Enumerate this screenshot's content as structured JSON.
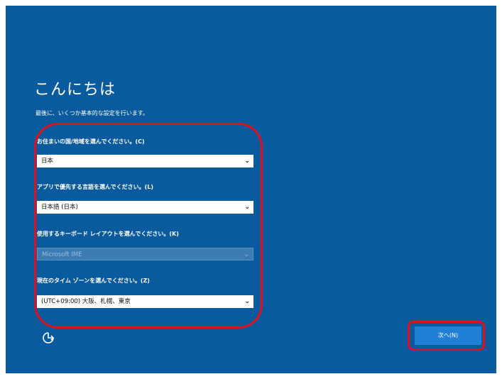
{
  "screen": {
    "title": "こんにちは",
    "subtitle": "最後に、いくつか基本的な設定を行います。"
  },
  "fields": {
    "region": {
      "label": "お住まいの国/地域を選んでください。(C)",
      "value": "日本"
    },
    "language": {
      "label": "アプリで優先する言語を選んでください。(L)",
      "value": "日本語 (日本)"
    },
    "keyboard": {
      "label": "使用するキーボード レイアウトを選んでください。(K)",
      "value": "Microsoft IME"
    },
    "timezone": {
      "label": "現在のタイム ゾーンを選んでください。(Z)",
      "value": "(UTC+09:00) 大阪、札幌、東京"
    }
  },
  "next_label": "次へ(N)",
  "icons": {
    "dropdown": "chevron-down-icon",
    "accessibility": "ease-of-access-icon"
  },
  "colors": {
    "background": "#0a5a9e",
    "button": "#1f80d6",
    "highlight": "#e01020"
  }
}
